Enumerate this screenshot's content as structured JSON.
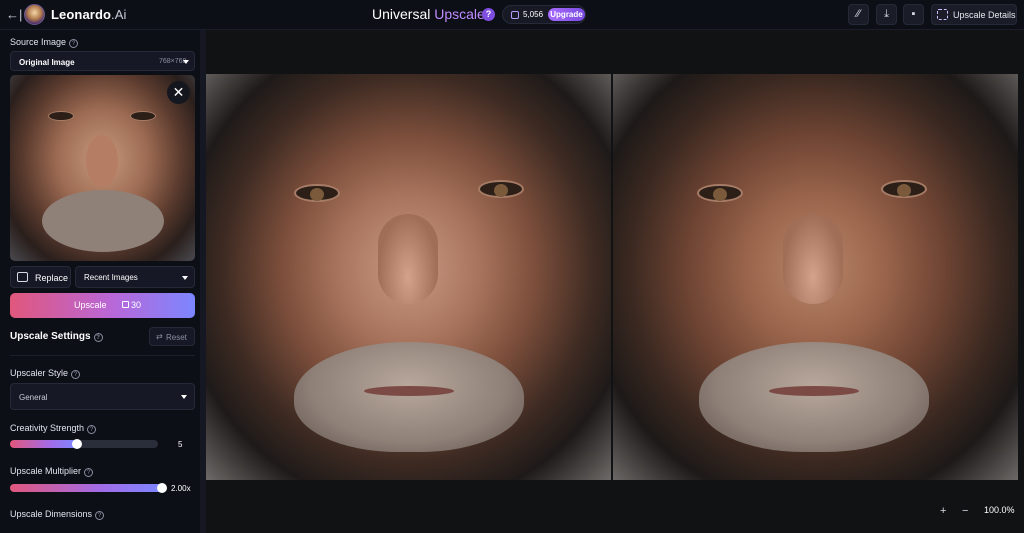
{
  "header": {
    "brand_name": "Leonardo",
    "brand_suffix": ".Ai",
    "title_main": "Universal",
    "title_accent": "Upscaler",
    "credits": "5,056",
    "upgrade_label": "Upgrade",
    "details_label": "Upscale Details",
    "icons": [
      "back-arrow-icon",
      "help-icon",
      "magic-wand-icon",
      "download-icon",
      "trash-icon",
      "dashed-frame-icon"
    ]
  },
  "sidebar": {
    "source_label": "Source Image",
    "source_select_value": "Original Image",
    "source_dims": "768×768",
    "replace_label": "Replace",
    "recent_label": "Recent Images",
    "upscale_label": "Upscale",
    "upscale_cost": "30",
    "settings_title": "Upscale Settings",
    "reset_label": "Reset",
    "style_label": "Upscaler Style",
    "style_value": "General",
    "creativity_label": "Creativity Strength",
    "creativity_value": "5",
    "creativity_fraction": 0.45,
    "multiplier_label": "Upscale Multiplier",
    "multiplier_value": "2.00x",
    "multiplier_fraction": 1.0,
    "dimensions_label": "Upscale Dimensions"
  },
  "canvas": {
    "zoom_in": "+",
    "zoom_out": "−",
    "zoom_value": "100.0%"
  }
}
